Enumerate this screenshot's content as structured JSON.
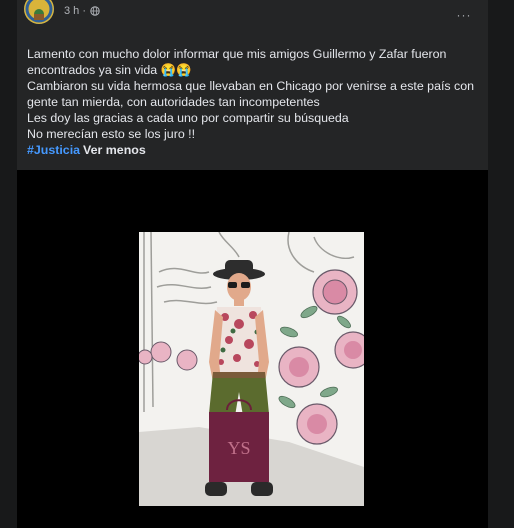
{
  "header": {
    "more_label": "···"
  },
  "post": {
    "timestamp": "3 h ·",
    "more_label": "···",
    "text_lines": [
      "Lamento con mucho dolor informar que mis amigos Guillermo y Zafar fueron",
      "encontrados ya sin vida 😭😭",
      "Cambiaron su vida hermosa que llevaban en Chicago por venirse a este país con",
      "gente tan mierda, con autoridades tan incompetentes",
      "Les doy las gracias a cada uno por compartir su búsqueda",
      "No merecían esto se los juro !!"
    ],
    "hashtag": "#Justicia",
    "see_less": "Ver menos"
  },
  "colors": {
    "page_bg": "#18191a",
    "card_bg": "#242526",
    "text": "#e4e6eb",
    "secondary_text": "#b0b3b8",
    "hashtag": "#4599ff",
    "media_bg": "#000000"
  }
}
